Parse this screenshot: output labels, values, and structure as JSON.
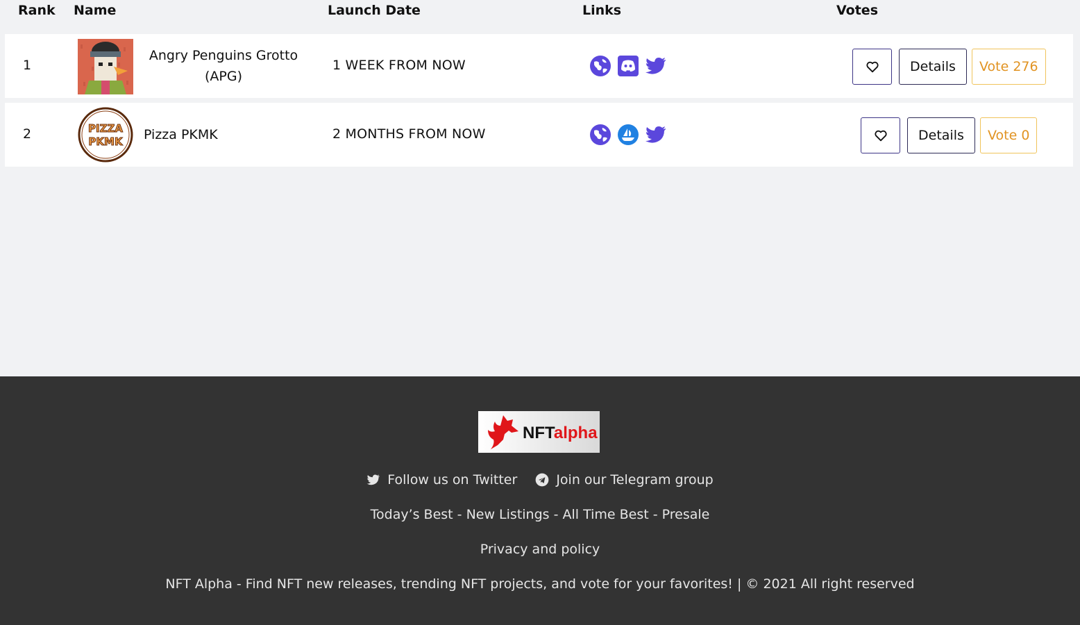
{
  "table": {
    "headers": {
      "rank": "Rank",
      "name": "Name",
      "launch_date": "Launch Date",
      "links": "Links",
      "votes": "Votes"
    },
    "rows": [
      {
        "rank": "1",
        "name": "Angry Penguins Grotto (APG)",
        "launch_date": "1 WEEK FROM NOW",
        "links": [
          "globe-icon",
          "discord-icon",
          "twitter-icon"
        ],
        "details_label": "Details",
        "vote_label": "Vote 276"
      },
      {
        "rank": "2",
        "name": "Pizza PKMK",
        "avatar_text_top": "PIZZA",
        "avatar_text_bottom": "PKMK",
        "launch_date": "2 MONTHS FROM NOW",
        "links": [
          "globe-icon",
          "opensea-icon",
          "twitter-icon"
        ],
        "details_label": "Details",
        "vote_label": "Vote 0"
      }
    ]
  },
  "footer": {
    "logo": {
      "prefix": "NFT",
      "suffix": "alpha"
    },
    "twitter_label": "Follow us on Twitter",
    "telegram_label": "Join our Telegram group",
    "nav": [
      "Today’s Best",
      "New Listings",
      "All Time Best",
      "Presale"
    ],
    "nav_separator": " - ",
    "privacy_label": "Privacy and policy",
    "copyright": "NFT Alpha - Find NFT new releases, trending NFT projects, and vote for your favorites! | © 2021 All right reserved"
  },
  "colors": {
    "accent": "#5b47dc",
    "vote": "#e19322",
    "vote_border": "#f0c35a",
    "footer_bg": "#333333",
    "page_bg": "#f1f2f4",
    "logo_red": "#e0161a"
  }
}
